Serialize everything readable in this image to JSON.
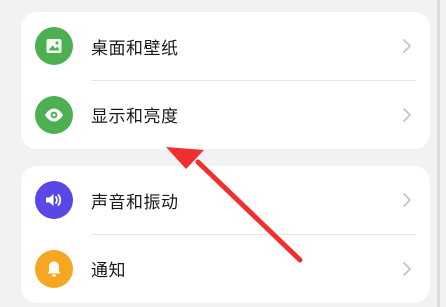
{
  "settings": {
    "group1": [
      {
        "label": "桌面和壁纸",
        "icon": "wallpaper-icon",
        "color": "#4caf50"
      },
      {
        "label": "显示和亮度",
        "icon": "eye-icon",
        "color": "#4caf50"
      }
    ],
    "group2": [
      {
        "label": "声音和振动",
        "icon": "speaker-icon",
        "color": "#5b46e6"
      },
      {
        "label": "通知",
        "icon": "bell-icon",
        "color": "#f5a623"
      }
    ]
  },
  "annotation": {
    "arrow_color": "#f02f2f"
  }
}
